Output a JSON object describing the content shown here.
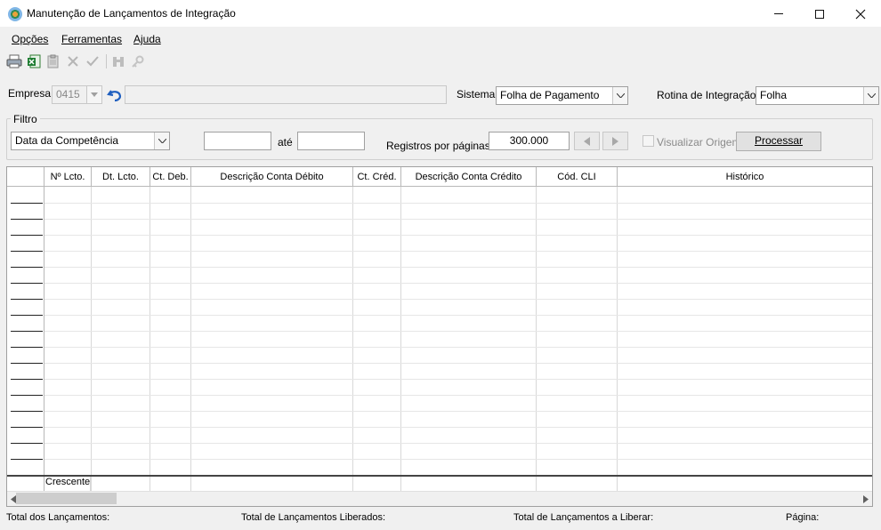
{
  "window": {
    "title": "Manutenção de Lançamentos de Integração",
    "minimize": "—",
    "maximize": "☐",
    "close": "✕"
  },
  "menu": [
    {
      "label": "Opções",
      "accel": "O"
    },
    {
      "label": "Ferramentas",
      "accel": "F"
    },
    {
      "label": "Ajuda",
      "accel": "A"
    }
  ],
  "toolbar": {
    "icons": [
      "printer-icon",
      "excel-icon",
      "clipboard-icon",
      "delete-icon",
      "check-icon",
      "binoculars-icon",
      "key-icon"
    ]
  },
  "empresa": {
    "label": "Empresa:",
    "value": "0415",
    "name_value": ""
  },
  "sistema": {
    "label": "Sistema:",
    "value": "Folha de Pagamento"
  },
  "rotina": {
    "label": "Rotina de Integração:",
    "value": "Folha"
  },
  "filtro": {
    "legend": "Filtro",
    "type_value": "Data da Competência",
    "from_value": "",
    "ate_label": "até",
    "to_value": "",
    "registros_label": "Registros por páginas:",
    "registros_value": "300.000",
    "visualizar_label": "Visualizar Origem",
    "processar_label": "Processar"
  },
  "grid": {
    "columns": [
      "Nº Lcto.",
      "Dt. Lcto.",
      "Ct. Deb.",
      "Descrição Conta Débito",
      "Ct. Créd.",
      "Descrição Conta Crédito",
      "Cód. CLI",
      "Histórico"
    ],
    "sort_label": "Crescente"
  },
  "status": {
    "total_lancamentos": "Total dos Lançamentos:",
    "total_liberados": "Total de Lançamentos Liberados:",
    "total_a_liberar": "Total de Lançamentos a Liberar:",
    "pagina": "Página:"
  },
  "colors": {
    "window_bg": "#f0f0f0",
    "grid_bg": "#ffffff",
    "accent_icon_blue": "#1f5fbf"
  }
}
